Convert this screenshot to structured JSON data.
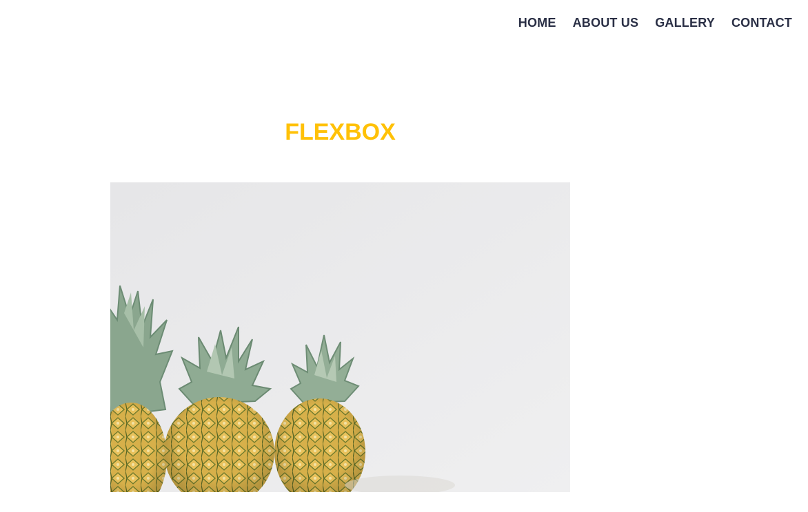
{
  "nav": {
    "items": [
      {
        "label": "HOME"
      },
      {
        "label": "ABOUT US"
      },
      {
        "label": "GALLERY"
      },
      {
        "label": "CONTACT"
      }
    ]
  },
  "main": {
    "title": "FLEXBOX",
    "image": {
      "alt": "pineapples"
    }
  },
  "colors": {
    "nav_text": "#2a2f45",
    "title": "#ffc107",
    "photo_bg": "#ebebeb"
  }
}
